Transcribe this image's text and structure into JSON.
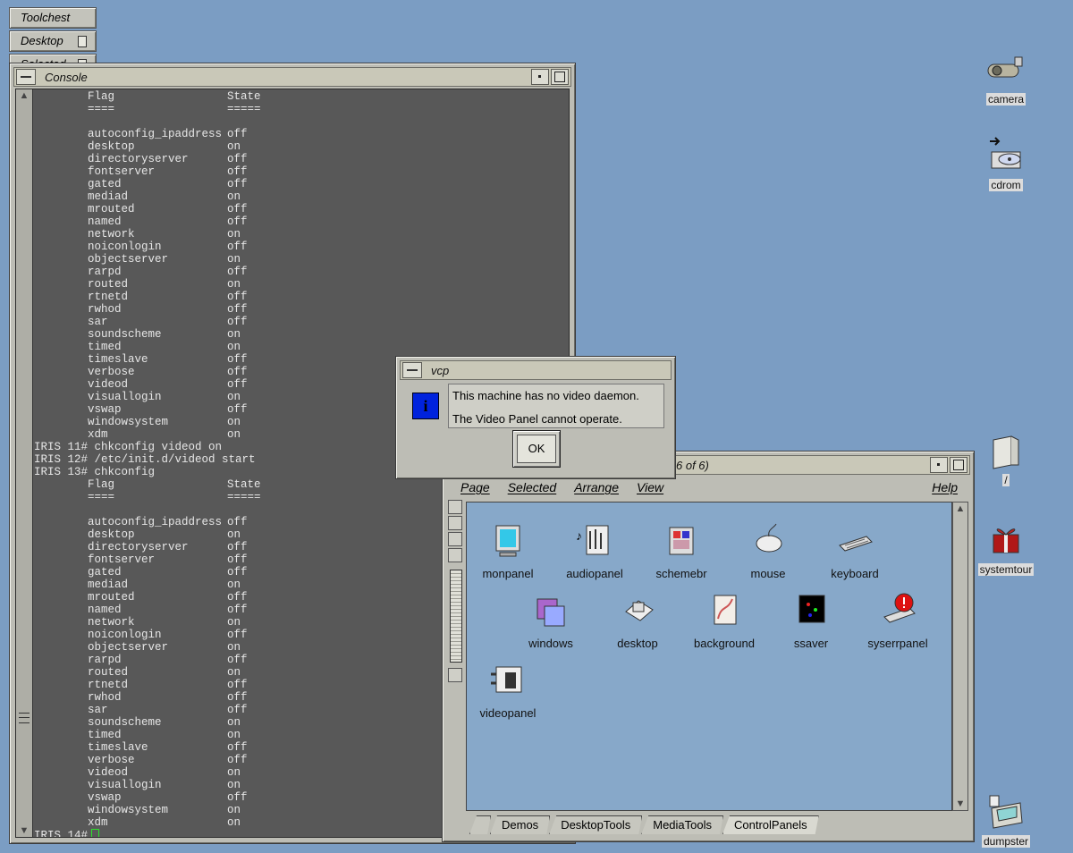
{
  "toolchest": {
    "title": "Toolchest",
    "items": [
      "Desktop",
      "Selected"
    ]
  },
  "console": {
    "title": "Console",
    "lines": [
      {
        "flag": "Flag",
        "state": "State"
      },
      {
        "flag": "====",
        "state": "====="
      },
      {
        "flag": "",
        "state": ""
      },
      {
        "flag": "autoconfig_ipaddress",
        "state": "off"
      },
      {
        "flag": "desktop",
        "state": "on"
      },
      {
        "flag": "directoryserver",
        "state": "off"
      },
      {
        "flag": "fontserver",
        "state": "off"
      },
      {
        "flag": "gated",
        "state": "off"
      },
      {
        "flag": "mediad",
        "state": "on"
      },
      {
        "flag": "mrouted",
        "state": "off"
      },
      {
        "flag": "named",
        "state": "off"
      },
      {
        "flag": "network",
        "state": "on"
      },
      {
        "flag": "noiconlogin",
        "state": "off"
      },
      {
        "flag": "objectserver",
        "state": "on"
      },
      {
        "flag": "rarpd",
        "state": "off"
      },
      {
        "flag": "routed",
        "state": "on"
      },
      {
        "flag": "rtnetd",
        "state": "off"
      },
      {
        "flag": "rwhod",
        "state": "off"
      },
      {
        "flag": "sar",
        "state": "off"
      },
      {
        "flag": "soundscheme",
        "state": "on"
      },
      {
        "flag": "timed",
        "state": "on"
      },
      {
        "flag": "timeslave",
        "state": "off"
      },
      {
        "flag": "verbose",
        "state": "off"
      },
      {
        "flag": "videod",
        "state": "off"
      },
      {
        "flag": "visuallogin",
        "state": "on"
      },
      {
        "flag": "vswap",
        "state": "off"
      },
      {
        "flag": "windowsystem",
        "state": "on"
      },
      {
        "flag": "xdm",
        "state": "on"
      },
      {
        "prompt": "IRIS 11# chkconfig videod on"
      },
      {
        "prompt": "IRIS 12# /etc/init.d/videod start"
      },
      {
        "prompt": "IRIS 13# chkconfig"
      },
      {
        "flag": "Flag",
        "state": "State"
      },
      {
        "flag": "====",
        "state": "====="
      },
      {
        "flag": "",
        "state": ""
      },
      {
        "flag": "autoconfig_ipaddress",
        "state": "off"
      },
      {
        "flag": "desktop",
        "state": "on"
      },
      {
        "flag": "directoryserver",
        "state": "off"
      },
      {
        "flag": "fontserver",
        "state": "off"
      },
      {
        "flag": "gated",
        "state": "off"
      },
      {
        "flag": "mediad",
        "state": "on"
      },
      {
        "flag": "mrouted",
        "state": "off"
      },
      {
        "flag": "named",
        "state": "off"
      },
      {
        "flag": "network",
        "state": "on"
      },
      {
        "flag": "noiconlogin",
        "state": "off"
      },
      {
        "flag": "objectserver",
        "state": "on"
      },
      {
        "flag": "rarpd",
        "state": "off"
      },
      {
        "flag": "routed",
        "state": "on"
      },
      {
        "flag": "rtnetd",
        "state": "off"
      },
      {
        "flag": "rwhod",
        "state": "off"
      },
      {
        "flag": "sar",
        "state": "off"
      },
      {
        "flag": "soundscheme",
        "state": "on"
      },
      {
        "flag": "timed",
        "state": "on"
      },
      {
        "flag": "timeslave",
        "state": "off"
      },
      {
        "flag": "verbose",
        "state": "off"
      },
      {
        "flag": "videod",
        "state": "on"
      },
      {
        "flag": "visuallogin",
        "state": "on"
      },
      {
        "flag": "vswap",
        "state": "off"
      },
      {
        "flag": "windowsystem",
        "state": "on"
      },
      {
        "flag": "xdm",
        "state": "on"
      }
    ],
    "current_prompt": "IRIS 14#"
  },
  "dialog": {
    "title": "vcp",
    "icon": "info-icon",
    "line1": "This machine has no video daemon.",
    "line2": "The Video Panel cannot operate.",
    "ok_label": "OK"
  },
  "panel": {
    "title_fragment": "6 of 6)",
    "menus": [
      "Page",
      "Selected",
      "Arrange",
      "View"
    ],
    "help": "Help",
    "icons": [
      {
        "label": "monpanel",
        "icon": "monitor-icon"
      },
      {
        "label": "audiopanel",
        "icon": "audio-icon"
      },
      {
        "label": "schemebr",
        "icon": "scheme-icon"
      },
      {
        "label": "mouse",
        "icon": "mouse-icon"
      },
      {
        "label": "keyboard",
        "icon": "keyboard-icon"
      },
      {
        "label": "windows",
        "icon": "windows-icon"
      },
      {
        "label": "desktop",
        "icon": "desktop-icon"
      },
      {
        "label": "background",
        "icon": "background-icon"
      },
      {
        "label": "ssaver",
        "icon": "screensaver-icon"
      },
      {
        "label": "syserrpanel",
        "icon": "error-icon"
      },
      {
        "label": "videopanel",
        "icon": "video-icon"
      }
    ],
    "tabs": [
      "Demos",
      "DesktopTools",
      "MediaTools",
      "ControlPanels"
    ]
  },
  "desktop_icons": [
    {
      "label": "camera",
      "icon": "camera-icon"
    },
    {
      "label": "cdrom",
      "icon": "cdrom-icon"
    },
    {
      "label": "/",
      "icon": "folder-icon"
    },
    {
      "label": "systemtour",
      "icon": "gift-icon"
    },
    {
      "label": "dumpster",
      "icon": "dumpster-icon"
    }
  ],
  "colors": {
    "desktop_bg": "#7b9dc3",
    "console_bg": "#585858",
    "panel_bg": "#87a8c9",
    "info_blue": "#0022dd",
    "cursor_green": "#2be22b"
  }
}
